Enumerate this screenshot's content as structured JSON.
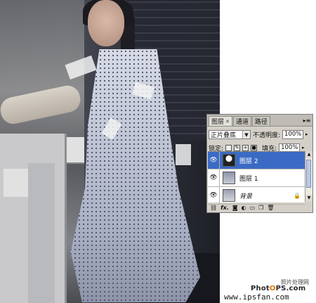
{
  "panel": {
    "tabs": [
      {
        "label": "图层",
        "active": true
      },
      {
        "label": "通道",
        "active": false
      },
      {
        "label": "路径",
        "active": false
      }
    ],
    "blend_mode": "正片叠底",
    "opacity_label": "不透明度:",
    "opacity_value": "100%",
    "lock_label": "锁定:",
    "fill_label": "填充:",
    "fill_value": "100%",
    "layers": [
      {
        "name": "图层 2",
        "selected": true,
        "visible": true
      },
      {
        "name": "图层 1",
        "selected": false,
        "visible": true
      },
      {
        "name": "背景",
        "selected": false,
        "visible": true,
        "locked": true
      }
    ],
    "bottom_fx": "fx.",
    "selection_color": "#3a6ac4"
  },
  "watermark": {
    "site_cn": "照片处理网",
    "logo_pre": "Phot",
    "logo_o": "O",
    "logo_post": "PS.com",
    "url": "www.ipsfan.com"
  }
}
